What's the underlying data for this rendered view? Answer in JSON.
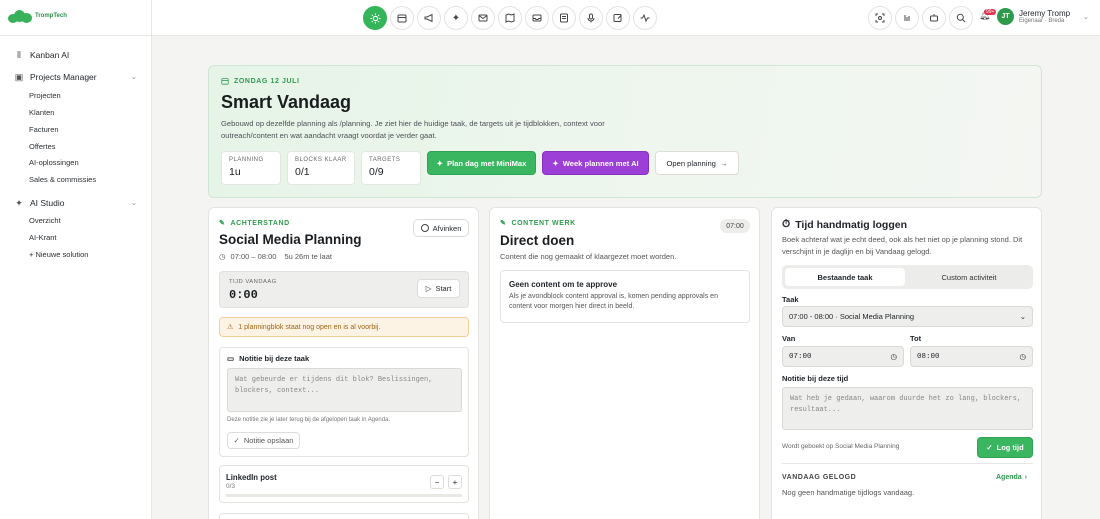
{
  "app": {
    "brand": "TrompTech"
  },
  "sidebar": {
    "kanban": "Kanban AI",
    "projects_manager": "Projects Manager",
    "projects_items": [
      "Projecten",
      "Klanten",
      "Facturen",
      "Offertes",
      "AI-oplossingen",
      "Sales & commissies"
    ],
    "ai_studio": "AI Studio",
    "ai_items": [
      "Overzicht",
      "AI-Krant",
      "+ Nieuwe solution"
    ]
  },
  "topnav": {
    "icons": [
      "sun-icon",
      "calendar-icon",
      "megaphone-icon",
      "sparkles-icon",
      "mail-icon",
      "map-icon",
      "inbox-icon",
      "newspaper-icon",
      "microphone-icon",
      "edit-icon",
      "activity-icon"
    ],
    "right_icons": [
      "scan-icon",
      "bar-chart-icon",
      "robot-icon",
      "search-icon"
    ],
    "notification_count": "99+"
  },
  "user": {
    "initials": "JT",
    "name": "Jeremy Tromp",
    "role": "Eigenaar · Breda"
  },
  "hero": {
    "date": "ZONDAG 12 JULI",
    "title": "Smart Vandaag",
    "description": "Gebouwd op dezelfde planning als /planning. Je ziet hier de huidige taak, de targets uit je tijdblokken, context voor outreach/content en wat aandacht vraagt voordat je verder gaat.",
    "stats": [
      {
        "label": "PLANNING",
        "value": "1u"
      },
      {
        "label": "BLOCKS KLAAR",
        "value": "0/1"
      },
      {
        "label": "TARGETS",
        "value": "0/9"
      }
    ],
    "btn_minimax": "Plan dag met MiniMax",
    "btn_week": "Week plannen met AI",
    "btn_open": "Open planning"
  },
  "achterstand": {
    "eyebrow": "ACHTERSTAND",
    "title": "Social Media Planning",
    "afvinken": "Afvinken",
    "time": "07:00 – 08:00",
    "late": "5u 26m te laat",
    "timer_label": "TIJD VANDAAG",
    "timer_value": "0:00",
    "start": "Start",
    "warning": "1 planningblok staat nog open en is al voorbij.",
    "note_title": "Notitie bij deze taak",
    "note_placeholder": "Wat gebeurde er tijdens dit blok? Beslissingen, blockers, context...",
    "note_hint": "Deze notitie zie je later terug bij de afgelopen taak in Agenda.",
    "note_save": "Notitie opslaan",
    "target_name": "LinkedIn post",
    "target_count": "0/3",
    "target_progress": 0
  },
  "content": {
    "eyebrow": "CONTENT WERK",
    "time_badge": "07:00",
    "title": "Direct doen",
    "subtitle": "Content die nog gemaakt of klaargezet moet worden.",
    "empty_title": "Geen content om te approve",
    "empty_desc": "Als je avondblock content approval is, komen pending approvals en content voor morgen hier direct in beeld."
  },
  "log": {
    "title": "Tijd handmatig loggen",
    "desc": "Boek achteraf wat je echt deed, ook als het niet op je planning stond. Dit verschijnt in je daglijn en bij Vandaag gelogd.",
    "tab_existing": "Bestaande taak",
    "tab_custom": "Custom activiteit",
    "task_label": "Taak",
    "task_value": "07:00 - 08:00 · Social Media Planning",
    "from_label": "Van",
    "from_value": "07:00",
    "to_label": "Tot",
    "to_value": "08:00",
    "note_label": "Notitie bij deze tijd",
    "note_placeholder": "Wat heb je gedaan, waarom duurde het zo lang, blockers, resultaat...",
    "booked_on": "Wordt geboekt op Social Media Planning",
    "log_btn": "Log tijd",
    "today_label": "VANDAAG GELOGD",
    "agenda_link": "Agenda",
    "empty": "Nog geen handmatige tijdlogs vandaag."
  },
  "colors": {
    "accent": "#34b559",
    "purple": "#9b3fd6",
    "warning_bg": "#fdf3e4"
  }
}
